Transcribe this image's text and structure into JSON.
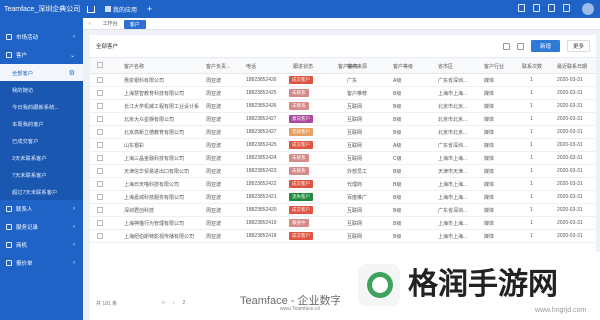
{
  "topbar": {
    "brand": "Teamface_深圳企典公司",
    "app_label": "我的应用",
    "add_label": "+"
  },
  "sidebar": {
    "items": [
      {
        "label": "市场活动"
      },
      {
        "label": "客户"
      },
      {
        "label": "联系人"
      },
      {
        "label": "服务记录"
      },
      {
        "label": "商机"
      },
      {
        "label": "报价单"
      }
    ],
    "sub_items": [
      {
        "label": "全部客户"
      },
      {
        "label": "我的随访"
      },
      {
        "label": "今日我的跟新系统..."
      },
      {
        "label": "本周我的客户"
      },
      {
        "label": "已成交客户"
      },
      {
        "label": "3天未联系客户"
      },
      {
        "label": "7天未联系客户"
      },
      {
        "label": "超过7天未联系客户"
      }
    ]
  },
  "tabs": {
    "items": [
      {
        "label": "工作台"
      },
      {
        "label": "客户"
      }
    ]
  },
  "main": {
    "title": "全部客户",
    "new_button": "新增",
    "more_button": "更多",
    "columns": [
      "客户名称",
      "客户负责...",
      "电话",
      "跟进状态",
      "客户等级",
      "客户来源",
      "客户等级",
      "省市区",
      "客户行业",
      "联系次数",
      "最近联系日期"
    ],
    "rows": [
      {
        "name": "惠泉银科有限公司",
        "owner": "周亚波",
        "phone": "18823852426",
        "status": "成交客户",
        "source": "广东",
        "level": "A级",
        "region": "广东省深圳...",
        "industry": "媒体",
        "count": "1",
        "date": "2020-03-31",
        "color": "#e0533f"
      },
      {
        "name": "上海慧智教育科技有限公司",
        "owner": "周亚波",
        "phone": "18823852425",
        "status": "未联系",
        "source": "客户推荐",
        "level": "B级",
        "region": "上海市上海...",
        "industry": "媒体",
        "count": "1",
        "date": "2020-03-31",
        "color": "#d78a88"
      },
      {
        "name": "长江大学机械工程有限工业设计系",
        "owner": "周亚波",
        "phone": "18823852426",
        "status": "未联系",
        "source": "互联网",
        "level": "B级",
        "region": "北京市北京...",
        "industry": "媒体",
        "count": "1",
        "date": "2020-03-31",
        "color": "#d78a88"
      },
      {
        "name": "北京大众星娱有限公司",
        "owner": "周亚波",
        "phone": "18823852427",
        "status": "意向客户",
        "source": "互联网",
        "level": "B级",
        "region": "北京市北京...",
        "industry": "媒体",
        "count": "1",
        "date": "2020-03-31",
        "color": "#b0489f"
      },
      {
        "name": "北京高新立德教育有限公司",
        "owner": "周亚波",
        "phone": "18823852427",
        "status": "无效客户",
        "source": "互联网",
        "level": "B级",
        "region": "北京市北京...",
        "industry": "媒体",
        "count": "1",
        "date": "2020-03-31",
        "color": "#e7a061"
      },
      {
        "name": "山东银彩",
        "owner": "周亚波",
        "phone": "18823852425",
        "status": "成交客户",
        "source": "互联网",
        "level": "A级",
        "region": "广东省深圳...",
        "industry": "媒体",
        "count": "1",
        "date": "2020-03-31",
        "color": "#e0533f"
      },
      {
        "name": "上海三晶金融科技有限公司",
        "owner": "周亚波",
        "phone": "18823852424",
        "status": "未联系",
        "source": "互联网",
        "level": "C级",
        "region": "上海市上海...",
        "industry": "媒体",
        "count": "1",
        "date": "2020-03-31",
        "color": "#d78a88"
      },
      {
        "name": "天津信华贸易进出口有限公司",
        "owner": "周亚波",
        "phone": "18823852423",
        "status": "未联系",
        "source": "外部员工",
        "level": "B级",
        "region": "天津市天津...",
        "industry": "媒体",
        "count": "1",
        "date": "2020-03-31",
        "color": "#d78a88"
      },
      {
        "name": "上海日天喵科技有限公司",
        "owner": "周亚波",
        "phone": "18823852422",
        "status": "成交客户",
        "source": "代理商",
        "level": "B级",
        "region": "上海市上海...",
        "industry": "媒体",
        "count": "1",
        "date": "2020-03-31",
        "color": "#e0533f"
      },
      {
        "name": "上海嘉城科技服务有限公司",
        "owner": "周亚波",
        "phone": "18823852421",
        "status": "流失客户",
        "source": "百度推广",
        "level": "B级",
        "region": "上海市上海...",
        "industry": "媒体",
        "count": "1",
        "date": "2020-03-31",
        "color": "#1f8a3a"
      },
      {
        "name": "深圳君创科技",
        "owner": "周亚波",
        "phone": "18823852420",
        "status": "成交客户",
        "source": "互联网",
        "level": "B级",
        "region": "广东省深圳...",
        "industry": "媒体",
        "count": "1",
        "date": "2020-03-31",
        "color": "#e0533f"
      },
      {
        "name": "上海神猫行为管理有限公司",
        "owner": "周亚波",
        "phone": "18823852419",
        "status": "跟进中",
        "source": "互联网",
        "level": "B级",
        "region": "上海市上海...",
        "industry": "媒体",
        "count": "1",
        "date": "2020-03-31",
        "color": "#d78a88"
      },
      {
        "name": "上海纽伯斯特影视传播有限公司",
        "owner": "周亚波",
        "phone": "18823852418",
        "status": "成交客户",
        "source": "互联网",
        "level": "B级",
        "region": "上海市上海...",
        "industry": "媒体",
        "count": "1",
        "date": "2020-03-31",
        "color": "#e0533f"
      }
    ],
    "footer": {
      "total": "共 181 条",
      "page": "2"
    }
  },
  "watermark": {
    "brand": "Teamface - 企业数字化管控",
    "url": "www.Teamface.cn"
  },
  "logo": {
    "name": "格润手游网",
    "site": "www.hngrjd.com"
  }
}
